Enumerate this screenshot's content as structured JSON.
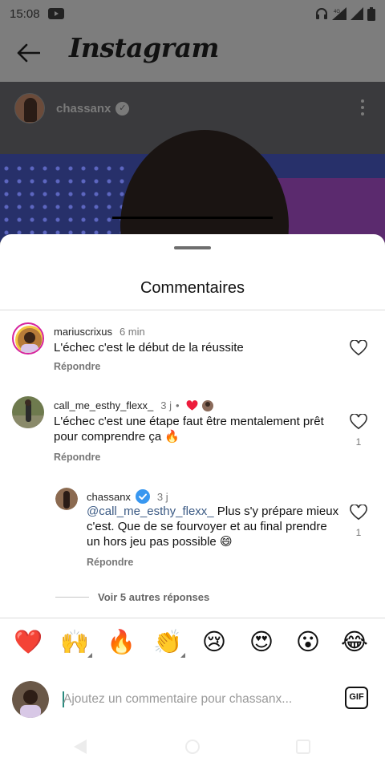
{
  "status_bar": {
    "time": "15:08",
    "network": "4G"
  },
  "app": {
    "logo": "Instagram"
  },
  "post": {
    "username": "chassanx"
  },
  "sheet": {
    "title": "Commentaires"
  },
  "comments": [
    {
      "username": "mariuscrixus",
      "time": "6 min",
      "text": "L'échec c'est le début de la réussite",
      "reply_label": "Répondre",
      "likes": ""
    },
    {
      "username": "call_me_esthy_flexx_",
      "time": "3 j",
      "separator": "•",
      "text_line1": "L'échec c'est une étape faut être mentalement prêt",
      "text_line2": "pour comprendre ça 🔥",
      "reply_label": "Répondre",
      "likes": "1"
    }
  ],
  "reply": {
    "username": "chassanx",
    "time": "3 j",
    "mention": "@call_me_esthy_flexx_",
    "text_line1_rest": " Plus s'y prépare mieux",
    "text_line2": "c'est. Que de se fourvoyer et au final prendre",
    "text_line3": "un hors jeu pas possible 😄",
    "reply_label": "Répondre",
    "likes": "1"
  },
  "more_replies": "Voir 5 autres réponses",
  "quick_emojis": [
    "❤️",
    "🙌",
    "🔥",
    "👏",
    "😢",
    "😍",
    "😮",
    "😂"
  ],
  "composer": {
    "placeholder": "Ajoutez un commentaire pour chassanx...",
    "value": "",
    "gif_label": "GIF"
  },
  "colors": {
    "heart_red": "#ed1c3c",
    "verified_blue": "#3897f0",
    "sheet_bg": "#ffffff",
    "dim_overlay": "#7d7d7d"
  }
}
